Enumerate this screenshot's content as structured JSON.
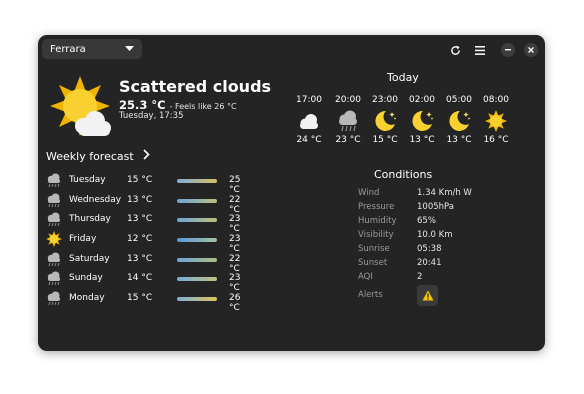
{
  "header": {
    "location": "Ferrara",
    "icons": {
      "dropdown": "chevron-down-icon",
      "refresh": "refresh-icon",
      "menu": "hamburger-menu-icon",
      "minimize": "minimize-icon",
      "close": "close-icon"
    }
  },
  "current": {
    "condition": "Scattered clouds",
    "temperature": "25.3 °C",
    "feels_like": "- Feels like 26 °C",
    "datetime": "Tuesday, 17:35",
    "icon": "sun-behind-cloud-icon"
  },
  "weekly": {
    "title": "Weekly forecast",
    "days": [
      {
        "day": "Tuesday",
        "low": "15 °C",
        "high": "25 °C",
        "icon": "rain-cloud-icon",
        "bar_color": "#c8c070"
      },
      {
        "day": "Wednesday",
        "low": "13 °C",
        "high": "22 °C",
        "icon": "rain-cloud-icon",
        "bar_color": "#8aa8b8"
      },
      {
        "day": "Thursday",
        "low": "13 °C",
        "high": "23 °C",
        "icon": "rain-cloud-icon",
        "bar_color": "#90b0c0"
      },
      {
        "day": "Friday",
        "low": "12 °C",
        "high": "23 °C",
        "icon": "sun-icon",
        "bar_color": "#72a8d8"
      },
      {
        "day": "Saturday",
        "low": "13 °C",
        "high": "22 °C",
        "icon": "rain-cloud-icon",
        "bar_color": "#82aac8"
      },
      {
        "day": "Sunday",
        "low": "14 °C",
        "high": "23 °C",
        "icon": "rain-cloud-icon",
        "bar_color": "#90b4c8"
      },
      {
        "day": "Monday",
        "low": "15 °C",
        "high": "26 °C",
        "icon": "rain-cloud-icon",
        "bar_color": "#c8c478"
      }
    ]
  },
  "today": {
    "title": "Today",
    "hours": [
      {
        "time": "17:00",
        "temp": "24 °C",
        "icon": "cloud-icon"
      },
      {
        "time": "20:00",
        "temp": "23 °C",
        "icon": "rain-cloud-icon"
      },
      {
        "time": "23:00",
        "temp": "15 °C",
        "icon": "moon-stars-icon"
      },
      {
        "time": "02:00",
        "temp": "13 °C",
        "icon": "moon-stars-icon"
      },
      {
        "time": "05:00",
        "temp": "13 °C",
        "icon": "moon-stars-icon"
      },
      {
        "time": "08:00",
        "temp": "16 °C",
        "icon": "sun-icon"
      }
    ]
  },
  "conditions": {
    "title": "Conditions",
    "items": [
      {
        "label": "Wind",
        "value": "1.34 Km/h W"
      },
      {
        "label": "Pressure",
        "value": "1005hPa"
      },
      {
        "label": "Humidity",
        "value": "65%"
      },
      {
        "label": "Visibility",
        "value": "10.0  Km"
      },
      {
        "label": "Sunrise",
        "value": "05:38"
      },
      {
        "label": "Sunset",
        "value": "20:41"
      },
      {
        "label": "AQI",
        "value": "2"
      }
    ],
    "alerts_label": "Alerts",
    "alert_icon": "warning-icon"
  }
}
